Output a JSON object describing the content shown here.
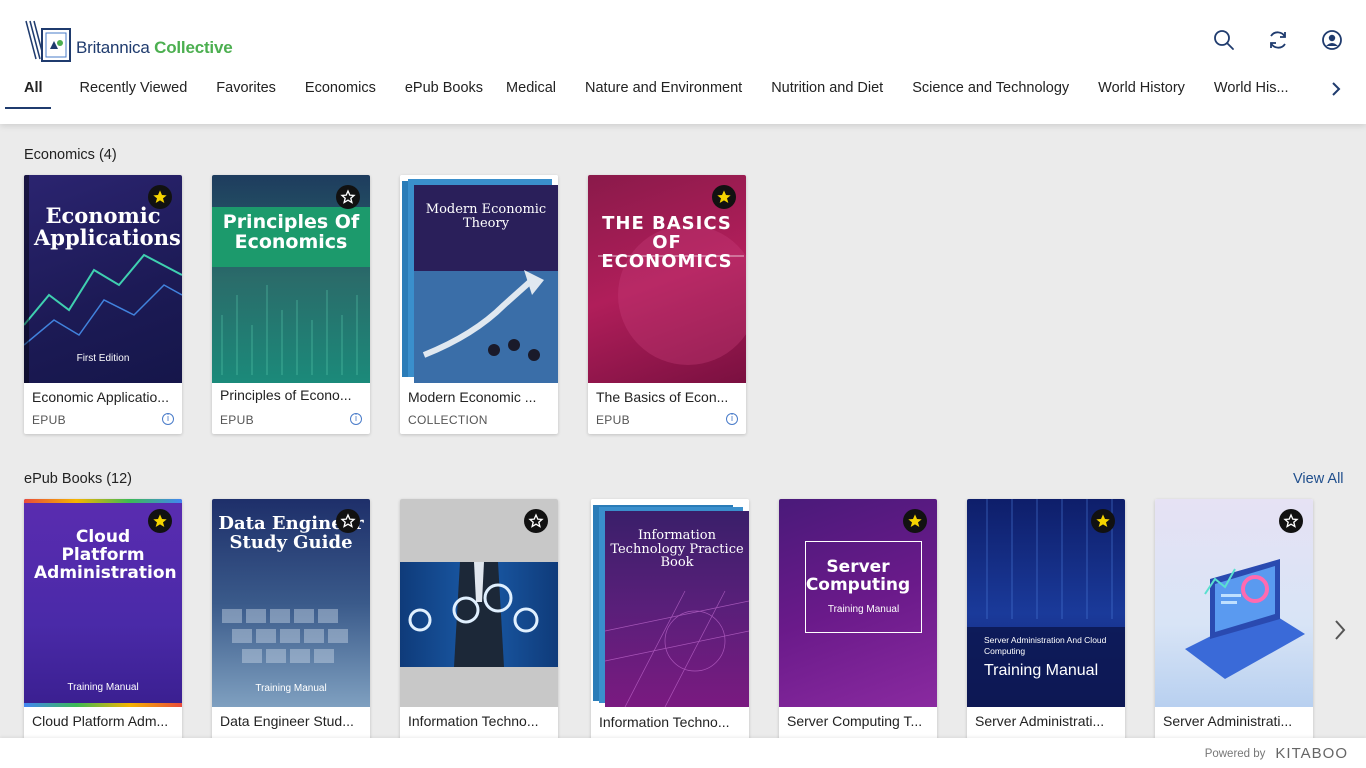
{
  "brand": {
    "name_part1": "Britannica",
    "name_part2": "Collective"
  },
  "header_icons": [
    "search-icon",
    "refresh-icon",
    "user-account-icon"
  ],
  "tabs": [
    {
      "label": "All",
      "active": true
    },
    {
      "label": "Recently Viewed"
    },
    {
      "label": "Favorites"
    },
    {
      "label": "Economics"
    },
    {
      "label": "ePub Books"
    },
    {
      "label": "Medical"
    },
    {
      "label": "Nature and Environment"
    },
    {
      "label": "Nutrition and Diet"
    },
    {
      "label": "Science and Technology"
    },
    {
      "label": "World History"
    },
    {
      "label": "World His..."
    }
  ],
  "sections": [
    {
      "title": "Economics (4)",
      "items": [
        {
          "cover_title": "Economic Applications",
          "cover_sub": "First Edition",
          "title": "Economic Applicatio...",
          "type": "EPUB",
          "favorite": true,
          "info": true
        },
        {
          "cover_title": "Principles Of Economics",
          "cover_sub": "",
          "title": "Principles of Econo...",
          "type": "EPUB",
          "favorite": false,
          "info": true
        },
        {
          "cover_title": "Modern Economic Theory",
          "cover_sub": "",
          "title": "Modern Economic ...",
          "type": "COLLECTION",
          "favorite": false,
          "info": false
        },
        {
          "cover_title": "THE BASICS OF ECONOMICS",
          "cover_sub": "",
          "title": "The Basics of Econ...",
          "type": "EPUB",
          "favorite": true,
          "info": true
        }
      ]
    },
    {
      "title": "ePub Books (12)",
      "view_all": "View All",
      "items": [
        {
          "cover_title": "Cloud Platform Administration",
          "cover_sub": "Training Manual",
          "title": "Cloud Platform Adm...",
          "favorite": true
        },
        {
          "cover_title": "Data Engineer Study Guide",
          "cover_sub": "Training Manual",
          "title": "Data Engineer Stud...",
          "favorite": false
        },
        {
          "cover_title": "",
          "cover_sub": "",
          "title": "Information Techno...",
          "favorite": false
        },
        {
          "cover_title": "Information Technology Practice Book",
          "cover_sub": "",
          "title": "Information Techno...",
          "favorite": false
        },
        {
          "cover_title": "Server Computing",
          "cover_sub": "Training Manual",
          "title": "Server Computing T...",
          "favorite": true
        },
        {
          "cover_title": "Server Administration And Cloud Computing",
          "cover_sub": "Training Manual",
          "title": "Server Administrati...",
          "favorite": true
        },
        {
          "cover_title": "",
          "cover_sub": "",
          "title": "Server Administrati...",
          "favorite": false
        }
      ]
    }
  ],
  "footer": {
    "powered_by": "Powered by",
    "provider": "KITABOO"
  },
  "colors": {
    "brand_blue": "#1f3b6e",
    "brand_green": "#4caf50",
    "link": "#1f4e8c",
    "favorite_star": "#f5d400"
  }
}
